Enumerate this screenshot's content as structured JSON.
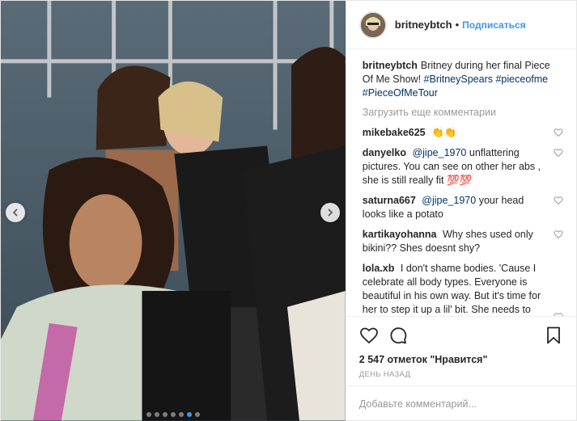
{
  "post": {
    "author": "britneybtch",
    "separator": "•",
    "follow_label": "Подписаться"
  },
  "caption": {
    "user": "britneybtch",
    "text_lead": "Britney during her final Piece Of Me Show!",
    "tags": [
      "#BritneySpears",
      "#pieceofme",
      "#PieceOfMeTour"
    ]
  },
  "load_more_label": "Загрузить еще комментарии",
  "comments": [
    {
      "user": "mikebake625",
      "mention": "",
      "text": "👏👏"
    },
    {
      "user": "danyelko",
      "mention": "@jipe_1970",
      "text": "unflattering pictures. You can see on other her abs , she is still really fit 💯💯"
    },
    {
      "user": "saturna667",
      "mention": "@jipe_1970",
      "text": "your head looks like a potato"
    },
    {
      "user": "kartikayohanna",
      "mention": "",
      "text": "Why shes used only bikini?? Shes doesnt shy?"
    },
    {
      "user": "lola.xb",
      "mention": "",
      "text": "I don't shame bodies. 'Cause I celebrate all body types. Everyone is beautiful in his own way. But it's time for her to step it up a lil' bit. She needs to start dressing for her body type & her age. Hire a new glam squad. She is"
    }
  ],
  "likes_label": "2 547 отметок \"Нравится\"",
  "time_label": "день назад",
  "add_comment_placeholder": "Добавьте комментарий...",
  "carousel": {
    "count": 7,
    "active": 5
  },
  "colors": {
    "accent": "#3897f0",
    "link": "#003569",
    "muted": "#999999"
  }
}
